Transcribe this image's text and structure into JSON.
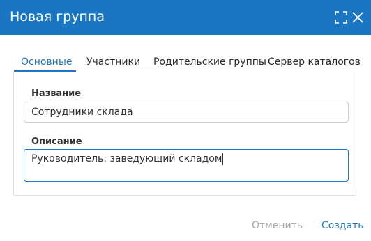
{
  "dialog": {
    "title": "Новая группа"
  },
  "tabs": [
    {
      "label": "Основные",
      "active": true
    },
    {
      "label": "Участники",
      "active": false
    },
    {
      "label": "Родительские группы",
      "active": false
    },
    {
      "label": "Сервер каталогов",
      "active": false
    }
  ],
  "form": {
    "name_label": "Название",
    "name_value": "Сотрудники склада",
    "description_label": "Описание",
    "description_value": "Руководитель: заведующий складом"
  },
  "footer": {
    "cancel_label": "Отменить",
    "create_label": "Создать"
  },
  "colors": {
    "accent": "#1a76c2",
    "disabled_text": "#a6a6a6"
  },
  "icons": {
    "maximize": "maximize-icon",
    "close": "close-icon"
  }
}
